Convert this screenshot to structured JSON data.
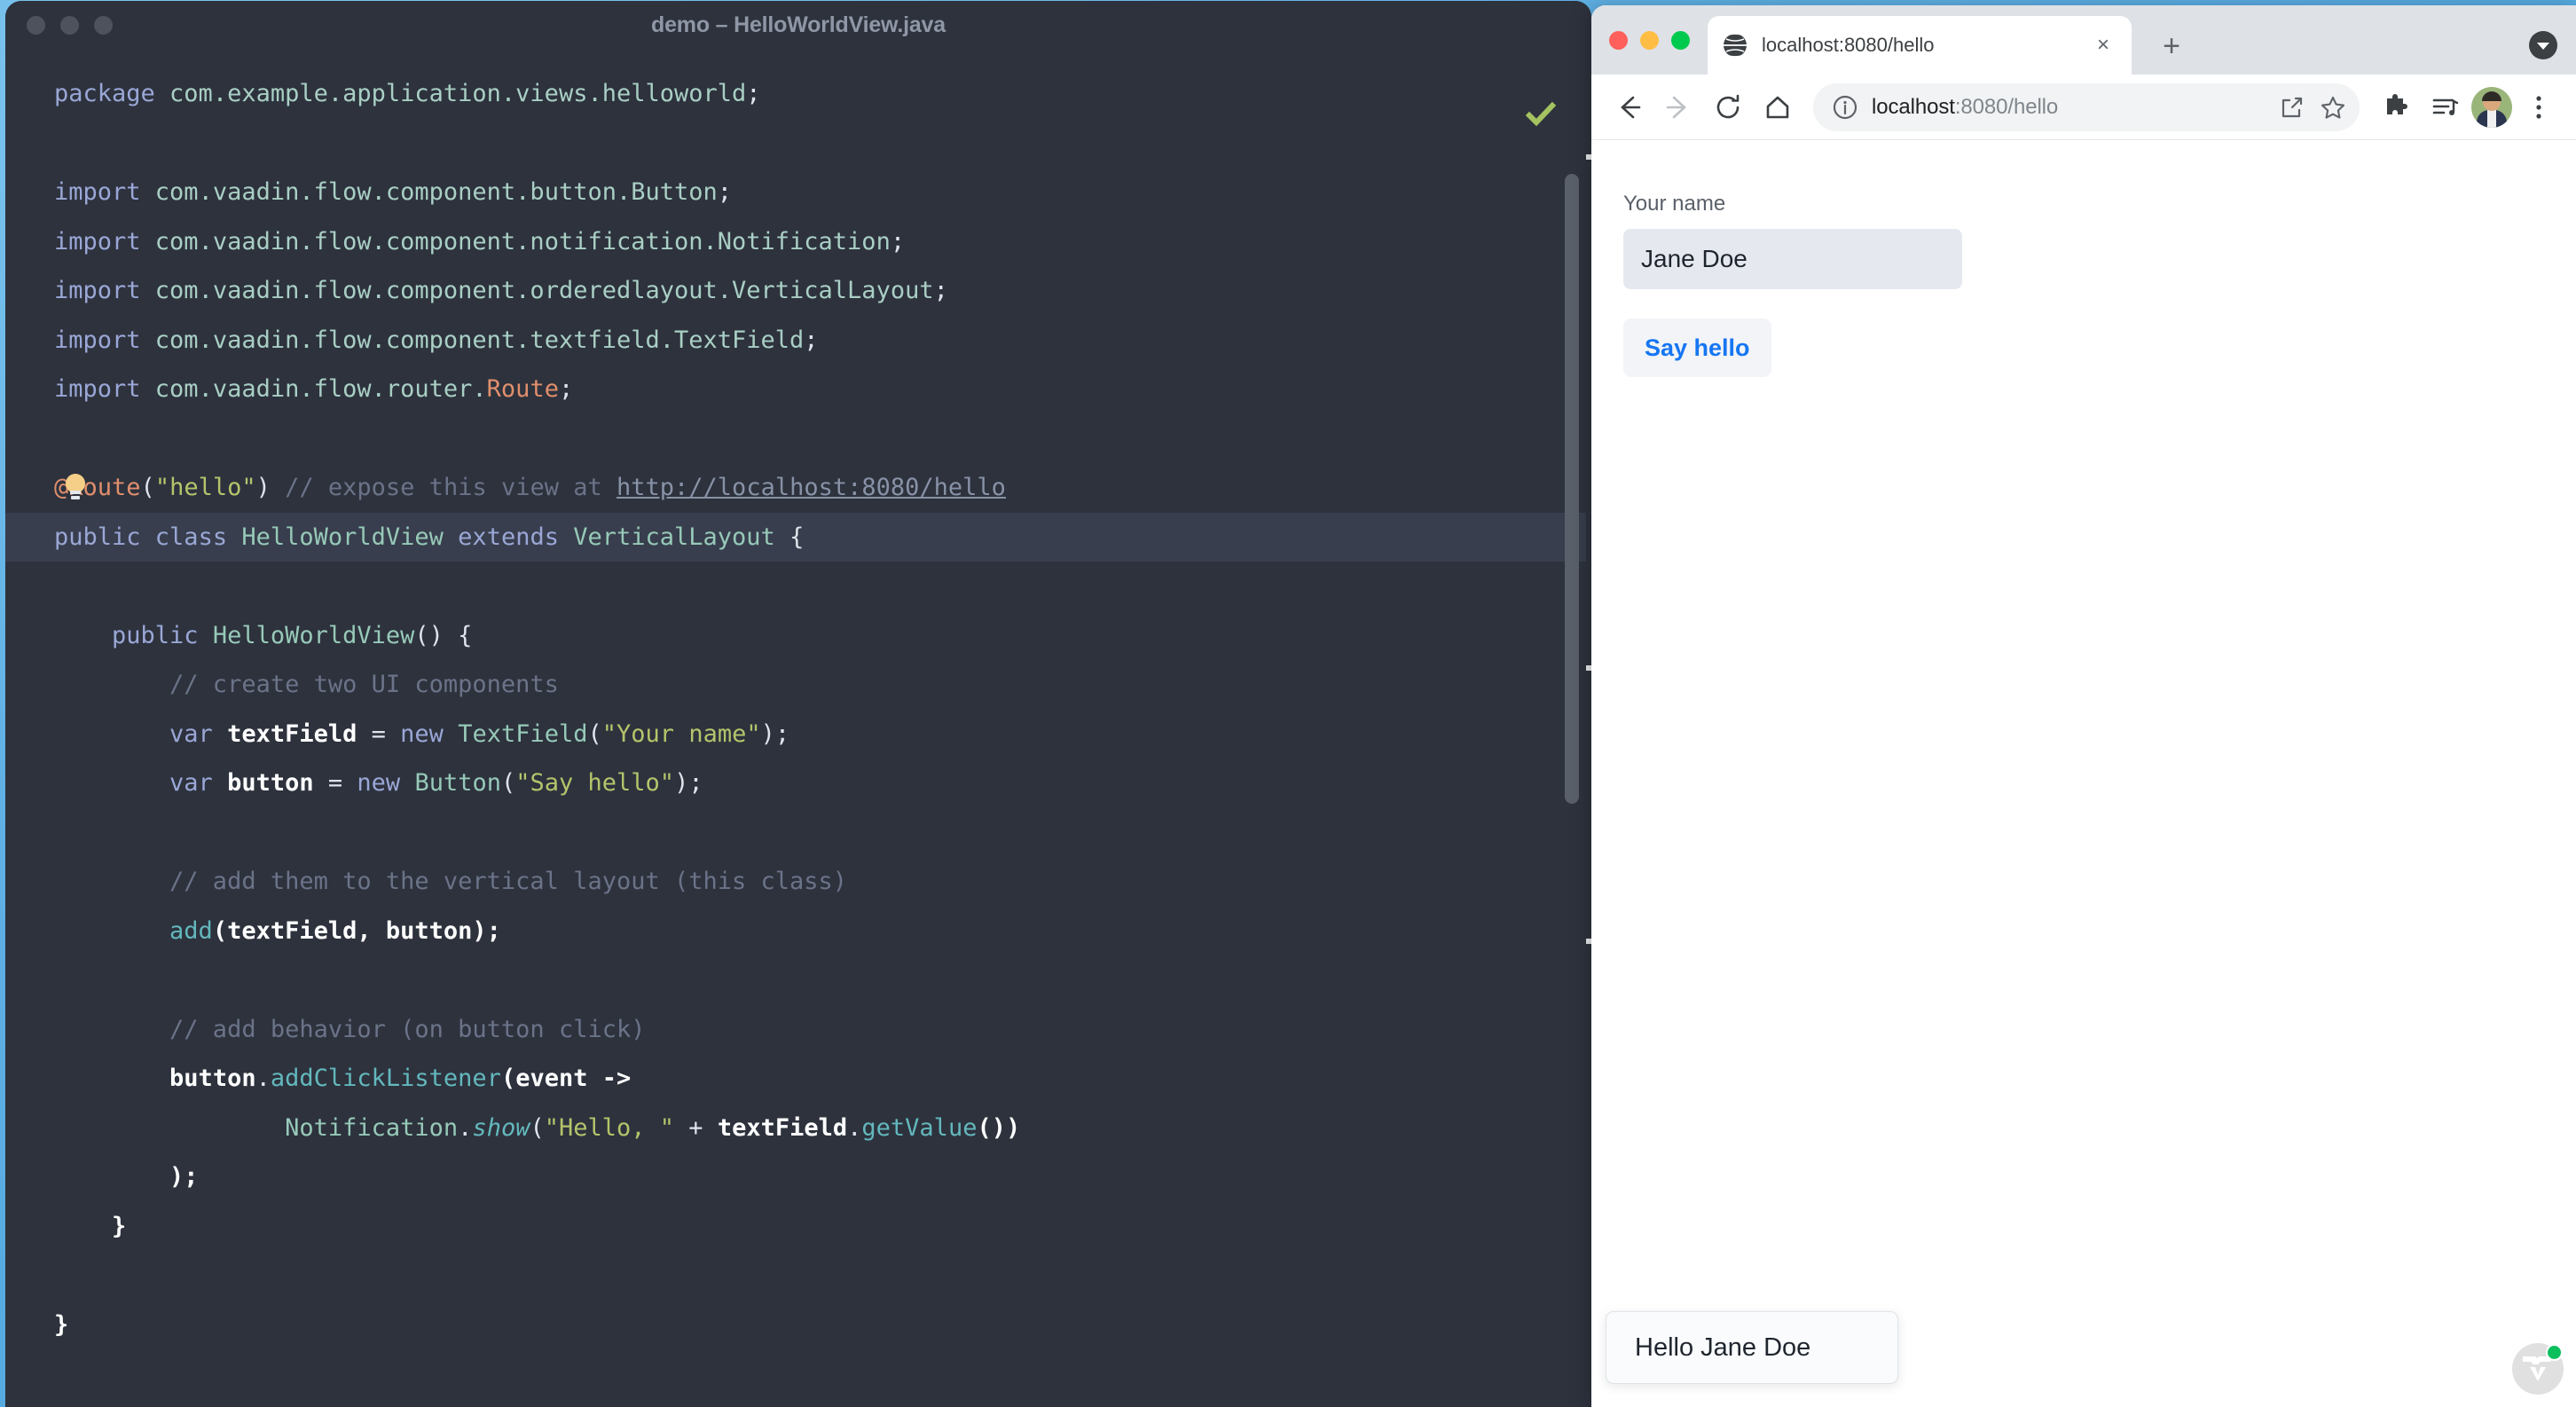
{
  "ide": {
    "title": "demo – HelloWorldView.java",
    "traffic_lights": [
      "close",
      "minimize",
      "maximize"
    ],
    "inspection_status_icon": "green-check-icon",
    "code_lines": [
      {
        "id": "l1",
        "highlight": false,
        "tokens": [
          {
            "t": "package ",
            "c": "k"
          },
          {
            "t": "com.example.application.views.helloworld",
            "c": "pkg"
          },
          {
            "t": ";",
            "c": "pl"
          }
        ]
      },
      {
        "id": "l2",
        "highlight": false,
        "tokens": []
      },
      {
        "id": "l3",
        "highlight": false,
        "tokens": [
          {
            "t": "import ",
            "c": "k"
          },
          {
            "t": "com.vaadin.flow.component.button.Button",
            "c": "pkg"
          },
          {
            "t": ";",
            "c": "pl"
          }
        ]
      },
      {
        "id": "l4",
        "highlight": false,
        "tokens": [
          {
            "t": "import ",
            "c": "k"
          },
          {
            "t": "com.vaadin.flow.component.notification.Notification",
            "c": "pkg"
          },
          {
            "t": ";",
            "c": "pl"
          }
        ]
      },
      {
        "id": "l5",
        "highlight": false,
        "tokens": [
          {
            "t": "import ",
            "c": "k"
          },
          {
            "t": "com.vaadin.flow.component.orderedlayout.VerticalLayout",
            "c": "pkg"
          },
          {
            "t": ";",
            "c": "pl"
          }
        ]
      },
      {
        "id": "l6",
        "highlight": false,
        "tokens": [
          {
            "t": "import ",
            "c": "k"
          },
          {
            "t": "com.vaadin.flow.component.textfield.TextField",
            "c": "pkg"
          },
          {
            "t": ";",
            "c": "pl"
          }
        ]
      },
      {
        "id": "l7",
        "highlight": false,
        "tokens": [
          {
            "t": "import ",
            "c": "k"
          },
          {
            "t": "com.vaadin.flow.router.",
            "c": "pkg"
          },
          {
            "t": "Route",
            "c": "ann"
          },
          {
            "t": ";",
            "c": "pl"
          }
        ]
      },
      {
        "id": "l8",
        "highlight": false,
        "tokens": []
      },
      {
        "id": "l9",
        "highlight": false,
        "bulb": true,
        "tokens": [
          {
            "t": "@Route",
            "c": "ann"
          },
          {
            "t": "(",
            "c": "pl"
          },
          {
            "t": "\"hello\"",
            "c": "str"
          },
          {
            "t": ")",
            "c": "pl"
          },
          {
            "t": " // expose this view at ",
            "c": "cmt"
          },
          {
            "t": "http://localhost:8080/hello",
            "c": "lnk"
          }
        ]
      },
      {
        "id": "l10",
        "highlight": true,
        "tokens": [
          {
            "t": "public ",
            "c": "k"
          },
          {
            "t": "class ",
            "c": "k"
          },
          {
            "t": "HelloWorldView",
            "c": "typ"
          },
          {
            "t": " extends ",
            "c": "k"
          },
          {
            "t": "VerticalLayout",
            "c": "typ"
          },
          {
            "t": " {",
            "c": "pl"
          }
        ]
      },
      {
        "id": "l11",
        "highlight": false,
        "tokens": []
      },
      {
        "id": "l12",
        "highlight": false,
        "tokens": [
          {
            "t": "    public ",
            "c": "k"
          },
          {
            "t": "HelloWorldView",
            "c": "typ"
          },
          {
            "t": "() {",
            "c": "pl"
          }
        ]
      },
      {
        "id": "l13",
        "highlight": false,
        "tokens": [
          {
            "t": "        // create two UI components",
            "c": "cmt"
          }
        ]
      },
      {
        "id": "l14",
        "highlight": false,
        "tokens": [
          {
            "t": "        var ",
            "c": "k"
          },
          {
            "t": "textField",
            "c": "fld"
          },
          {
            "t": " = ",
            "c": "op"
          },
          {
            "t": "new ",
            "c": "k"
          },
          {
            "t": "TextField",
            "c": "typ"
          },
          {
            "t": "(",
            "c": "pl"
          },
          {
            "t": "\"Your name\"",
            "c": "str"
          },
          {
            "t": ");",
            "c": "pl"
          }
        ]
      },
      {
        "id": "l15",
        "highlight": false,
        "tokens": [
          {
            "t": "        var ",
            "c": "k"
          },
          {
            "t": "button",
            "c": "fld"
          },
          {
            "t": " = ",
            "c": "op"
          },
          {
            "t": "new ",
            "c": "k"
          },
          {
            "t": "Button",
            "c": "typ"
          },
          {
            "t": "(",
            "c": "pl"
          },
          {
            "t": "\"Say hello\"",
            "c": "str"
          },
          {
            "t": ");",
            "c": "pl"
          }
        ]
      },
      {
        "id": "l16",
        "highlight": false,
        "tokens": []
      },
      {
        "id": "l17",
        "highlight": false,
        "tokens": [
          {
            "t": "        // add them to the vertical layout (this class)",
            "c": "cmt"
          }
        ]
      },
      {
        "id": "l18",
        "highlight": false,
        "tokens": [
          {
            "t": "        ",
            "c": "pl"
          },
          {
            "t": "add",
            "c": "mth"
          },
          {
            "t": "(textField, button);",
            "c": "fld"
          }
        ]
      },
      {
        "id": "l19",
        "highlight": false,
        "tokens": []
      },
      {
        "id": "l20",
        "highlight": false,
        "tokens": [
          {
            "t": "        // add behavior (on button click)",
            "c": "cmt"
          }
        ]
      },
      {
        "id": "l21",
        "highlight": false,
        "tokens": [
          {
            "t": "        ",
            "c": "pl"
          },
          {
            "t": "button",
            "c": "fld"
          },
          {
            "t": ".",
            "c": "pl"
          },
          {
            "t": "addClickListener",
            "c": "mth"
          },
          {
            "t": "(event -> ",
            "c": "fld"
          }
        ]
      },
      {
        "id": "l22",
        "highlight": false,
        "tokens": [
          {
            "t": "                ",
            "c": "pl"
          },
          {
            "t": "Notification",
            "c": "typ"
          },
          {
            "t": ".",
            "c": "pl"
          },
          {
            "t": "show",
            "c": "mthi"
          },
          {
            "t": "(",
            "c": "pl"
          },
          {
            "t": "\"Hello, \"",
            "c": "str"
          },
          {
            "t": " + ",
            "c": "op"
          },
          {
            "t": "textField",
            "c": "fld"
          },
          {
            "t": ".",
            "c": "pl"
          },
          {
            "t": "getValue",
            "c": "mth"
          },
          {
            "t": "())",
            "c": "fld"
          }
        ]
      },
      {
        "id": "l23",
        "highlight": false,
        "tokens": [
          {
            "t": "        );",
            "c": "fld"
          }
        ]
      },
      {
        "id": "l24",
        "highlight": false,
        "tokens": [
          {
            "t": "    }",
            "c": "fld"
          }
        ]
      },
      {
        "id": "l25",
        "highlight": false,
        "tokens": []
      },
      {
        "id": "l26",
        "highlight": false,
        "tokens": [
          {
            "t": "}",
            "c": "fld"
          }
        ]
      }
    ]
  },
  "browser": {
    "traffic_lights": [
      "close",
      "minimize",
      "maximize"
    ],
    "tab": {
      "title": "localhost:8080/hello",
      "favicon": "globe-icon",
      "close_label": "×"
    },
    "new_tab_label": "+",
    "tabstrip_menu_icon": "chevron-down-circle-icon",
    "toolbar": {
      "back_icon": "arrow-left-icon",
      "forward_icon": "arrow-right-icon",
      "reload_icon": "reload-icon",
      "home_icon": "home-icon",
      "info_icon": "info-circle-icon",
      "url_host": "localhost",
      "url_path": ":8080/hello",
      "share_icon": "share-icon",
      "bookmark_icon": "star-icon",
      "extensions_icon": "puzzle-icon",
      "reading_list_icon": "media-list-icon",
      "avatar_icon": "user-avatar",
      "menu_icon": "three-dot-menu-icon"
    },
    "page": {
      "field_label": "Your name",
      "field_value": "Jane Doe",
      "field_placeholder": "",
      "button_label": "Say hello",
      "toast_message": "Hello Jane Doe",
      "devtools_badge": {
        "logo": "vaadin-logo-icon",
        "status": "connected"
      }
    }
  },
  "colors": {
    "ide_bg": "#2d323d",
    "ide_line_highlight": "#383e4d",
    "browser_chrome": "#dee1e6",
    "accent_blue": "#1676f3",
    "field_bg": "#e5e9ef",
    "status_green": "#0bbf5d",
    "string_green": "#b5c46b",
    "annotation_orange": "#e08f6d"
  }
}
